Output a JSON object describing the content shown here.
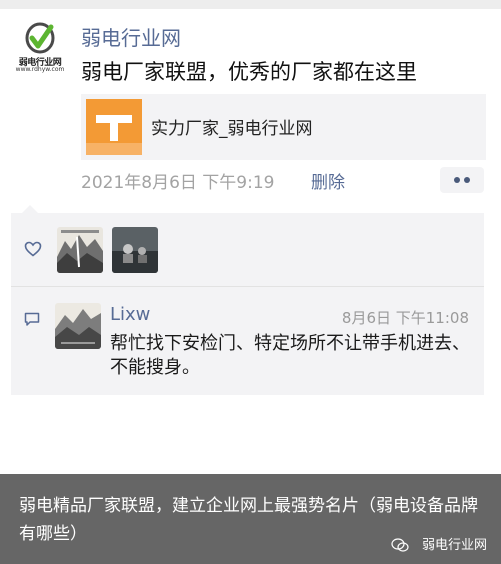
{
  "post": {
    "author": "弱电行业网",
    "avatar": {
      "logo_text": "弱电行业网",
      "logo_url": "www.rdhyw.com"
    },
    "text": "弱电厂家联盟，优秀的厂家都在这里",
    "link_card": {
      "title": "实力厂家_弱电行业网"
    },
    "time": "2021年8月6日 下午9:19",
    "delete_label": "删除"
  },
  "comment": {
    "author": "Lixw",
    "time": "8月6日 下午11:08",
    "text": "帮忙找下安检门、特定场所不让带手机进去、不能搜身。"
  },
  "watermark": {
    "caption": "弱电精品厂家联盟，建立企业网上最强势名片（弱电设备品牌有哪些）",
    "source": "弱电行业网"
  },
  "colors": {
    "link_blue": "#576b95",
    "thumb_orange": "#f39a35",
    "panel_gray": "#f3f3f5"
  }
}
